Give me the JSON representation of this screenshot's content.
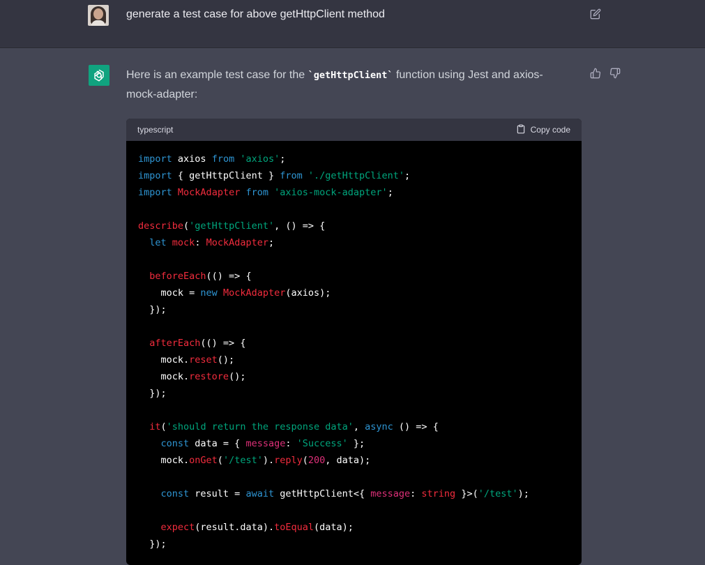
{
  "user_message": {
    "text": "generate a test case for above getHttpClient method"
  },
  "assistant_message": {
    "intro_before": "Here is an example test case for the ",
    "intro_code": "`getHttpClient`",
    "intro_after": " function using Jest and axios-mock-adapter:"
  },
  "code_block": {
    "language": "typescript",
    "copy_label": "Copy code",
    "lines": [
      [
        [
          "kw",
          "import"
        ],
        [
          "plain",
          " axios "
        ],
        [
          "kw",
          "from"
        ],
        [
          "plain",
          " "
        ],
        [
          "str",
          "'axios'"
        ],
        [
          "plain",
          ";"
        ]
      ],
      [
        [
          "kw",
          "import"
        ],
        [
          "plain",
          " { getHttpClient } "
        ],
        [
          "kw",
          "from"
        ],
        [
          "plain",
          " "
        ],
        [
          "str",
          "'./getHttpClient'"
        ],
        [
          "plain",
          ";"
        ]
      ],
      [
        [
          "kw",
          "import"
        ],
        [
          "plain",
          " "
        ],
        [
          "cls",
          "MockAdapter"
        ],
        [
          "plain",
          " "
        ],
        [
          "kw",
          "from"
        ],
        [
          "plain",
          " "
        ],
        [
          "str",
          "'axios-mock-adapter'"
        ],
        [
          "plain",
          ";"
        ]
      ],
      [],
      [
        [
          "fn",
          "describe"
        ],
        [
          "plain",
          "("
        ],
        [
          "str",
          "'getHttpClient'"
        ],
        [
          "plain",
          ", () => {"
        ]
      ],
      [
        [
          "plain",
          "  "
        ],
        [
          "kw",
          "let"
        ],
        [
          "plain",
          " "
        ],
        [
          "fn",
          "mock"
        ],
        [
          "plain",
          ": "
        ],
        [
          "cls",
          "MockAdapter"
        ],
        [
          "plain",
          ";"
        ]
      ],
      [],
      [
        [
          "plain",
          "  "
        ],
        [
          "fn",
          "beforeEach"
        ],
        [
          "plain",
          "(() => {"
        ]
      ],
      [
        [
          "plain",
          "    mock = "
        ],
        [
          "kw",
          "new"
        ],
        [
          "plain",
          " "
        ],
        [
          "cls",
          "MockAdapter"
        ],
        [
          "plain",
          "(axios);"
        ]
      ],
      [
        [
          "plain",
          "  });"
        ]
      ],
      [],
      [
        [
          "plain",
          "  "
        ],
        [
          "fn",
          "afterEach"
        ],
        [
          "plain",
          "(() => {"
        ]
      ],
      [
        [
          "plain",
          "    mock."
        ],
        [
          "fn",
          "reset"
        ],
        [
          "plain",
          "();"
        ]
      ],
      [
        [
          "plain",
          "    mock."
        ],
        [
          "fn",
          "restore"
        ],
        [
          "plain",
          "();"
        ]
      ],
      [
        [
          "plain",
          "  });"
        ]
      ],
      [],
      [
        [
          "plain",
          "  "
        ],
        [
          "fn",
          "it"
        ],
        [
          "plain",
          "("
        ],
        [
          "str",
          "'should return the response data'"
        ],
        [
          "plain",
          ", "
        ],
        [
          "kw",
          "async"
        ],
        [
          "plain",
          " () => {"
        ]
      ],
      [
        [
          "plain",
          "    "
        ],
        [
          "kw",
          "const"
        ],
        [
          "plain",
          " data = { "
        ],
        [
          "prop",
          "message"
        ],
        [
          "plain",
          ": "
        ],
        [
          "str",
          "'Success'"
        ],
        [
          "plain",
          " };"
        ]
      ],
      [
        [
          "plain",
          "    mock."
        ],
        [
          "fn",
          "onGet"
        ],
        [
          "plain",
          "("
        ],
        [
          "str",
          "'/test'"
        ],
        [
          "plain",
          ")."
        ],
        [
          "fn",
          "reply"
        ],
        [
          "plain",
          "("
        ],
        [
          "num",
          "200"
        ],
        [
          "plain",
          ", data);"
        ]
      ],
      [],
      [
        [
          "plain",
          "    "
        ],
        [
          "kw",
          "const"
        ],
        [
          "plain",
          " result = "
        ],
        [
          "kw",
          "await"
        ],
        [
          "plain",
          " getHttpClient<{ "
        ],
        [
          "prop",
          "message"
        ],
        [
          "plain",
          ": "
        ],
        [
          "fn",
          "string"
        ],
        [
          "plain",
          " }>("
        ],
        [
          "str",
          "'/test'"
        ],
        [
          "plain",
          ");"
        ]
      ],
      [],
      [
        [
          "plain",
          "    "
        ],
        [
          "fn",
          "expect"
        ],
        [
          "plain",
          "(result.data)."
        ],
        [
          "fn",
          "toEqual"
        ],
        [
          "plain",
          "(data);"
        ]
      ],
      [
        [
          "plain",
          "  });"
        ]
      ]
    ]
  },
  "icons": {
    "edit": "edit-icon",
    "thumbs_up": "thumbs-up-icon",
    "thumbs_down": "thumbs-down-icon",
    "clipboard": "clipboard-icon",
    "openai_logo": "openai-logo-icon"
  },
  "colors": {
    "user_bg": "#343541",
    "assistant_bg": "#444654",
    "code_bg": "#000000",
    "accent": "#10a37f"
  }
}
